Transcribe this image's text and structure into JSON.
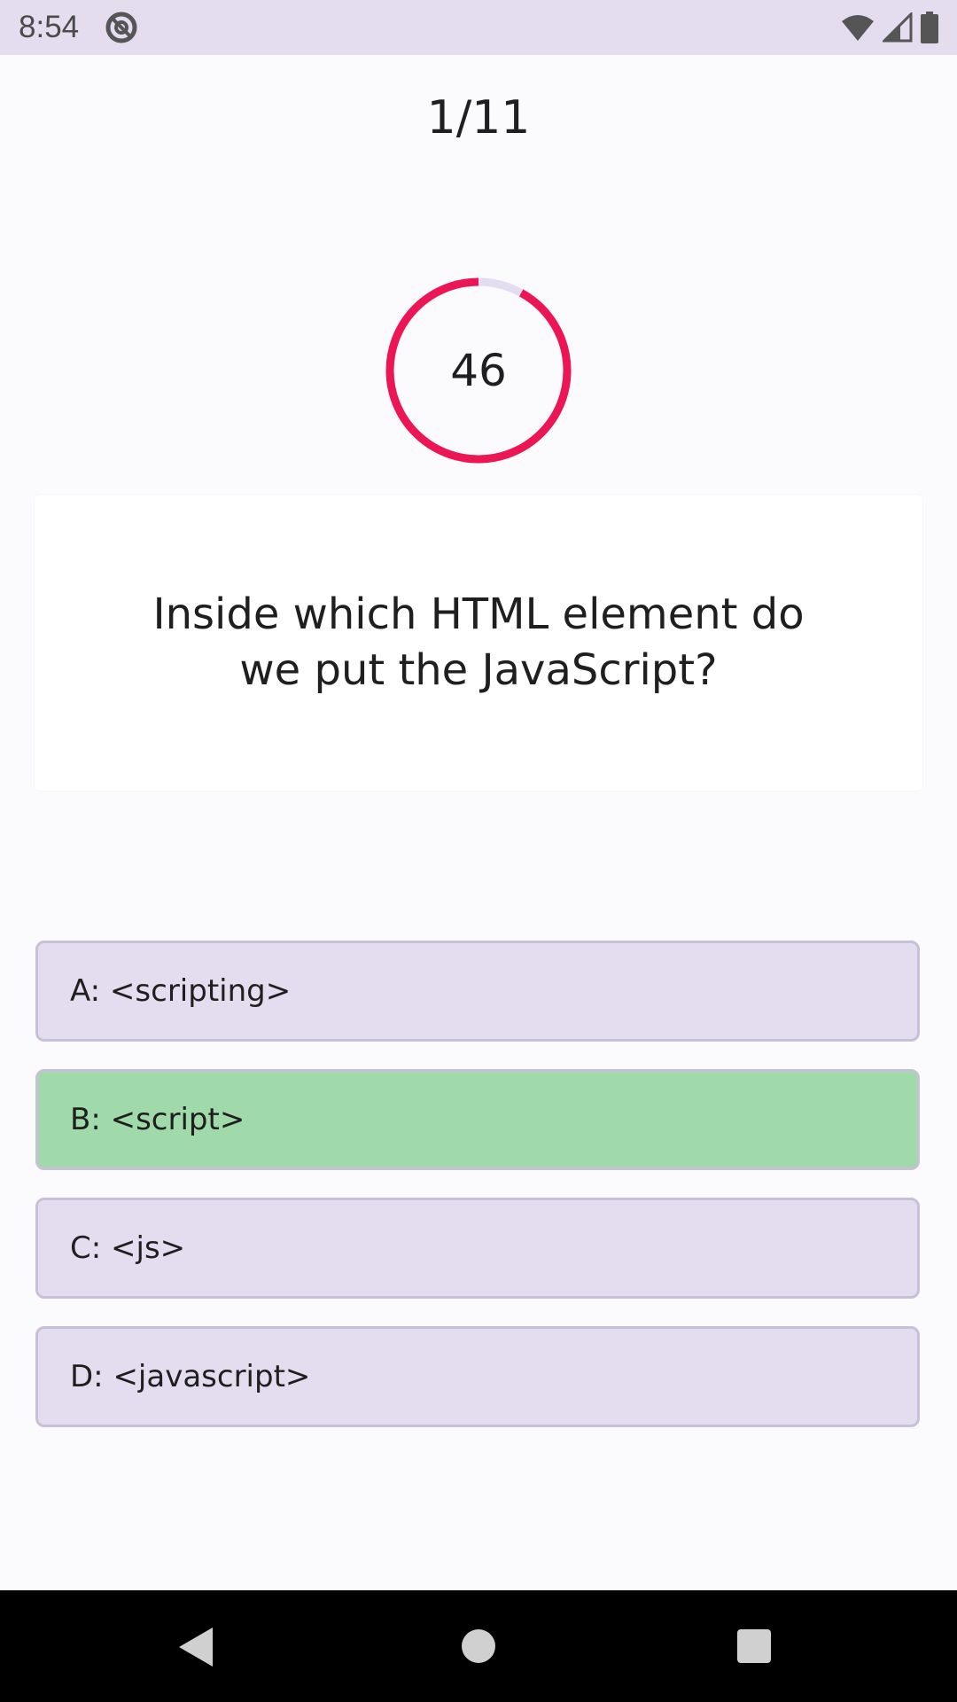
{
  "status_bar": {
    "time": "8:54",
    "icons": [
      "do-not-disturb-icon",
      "wifi-icon",
      "cell-signal-icon",
      "battery-icon"
    ]
  },
  "quiz": {
    "counter": "1/11",
    "timer": {
      "seconds_left": "46",
      "progress_fraction": 0.92,
      "ring_color": "#ec1654",
      "track_color": "#e4dcef"
    },
    "question": "Inside which HTML element do we put the JavaScript?",
    "answers": [
      {
        "label": "A: <scripting>",
        "state": "default"
      },
      {
        "label": "B: <script>",
        "state": "correct"
      },
      {
        "label": "C: <js>",
        "state": "default"
      },
      {
        "label": "D: <javascript>",
        "state": "default"
      }
    ]
  },
  "colors": {
    "answer_default": "#e4dcef",
    "answer_correct": "#a0d9aa",
    "status_bar": "#e4dcef"
  },
  "nav": {
    "icons": [
      "back-icon",
      "home-icon",
      "recents-icon"
    ]
  }
}
